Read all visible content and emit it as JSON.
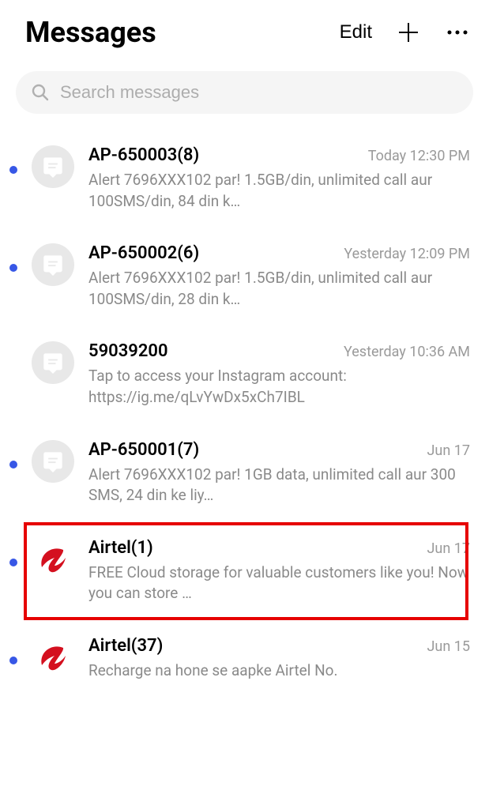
{
  "header": {
    "title": "Messages",
    "edit_label": "Edit"
  },
  "search": {
    "placeholder": "Search messages"
  },
  "conversations": [
    {
      "title": "AP-650003(8)",
      "time": "Today 12:30 PM",
      "preview": "Alert 7696XXX102 par! 1.5GB/din, unlimited call aur 100SMS/din, 84 din k…",
      "unread": true,
      "avatar": "chat",
      "highlighted": false
    },
    {
      "title": "AP-650002(6)",
      "time": "Yesterday 12:09 PM",
      "preview": "Alert 7696XXX102 par! 1.5GB/din, unlimited call aur 100SMS/din, 28 din k…",
      "unread": true,
      "avatar": "chat",
      "highlighted": false
    },
    {
      "title": "59039200",
      "time": "Yesterday 10:36 AM",
      "preview": "Tap to access your Instagram account: https://ig.me/qLvYwDx5xCh7IBL",
      "unread": false,
      "avatar": "chat",
      "highlighted": false
    },
    {
      "title": "AP-650001(7)",
      "time": "Jun 17",
      "preview": "Alert 7696XXX102 par!  1GB data, unlimited call aur 300 SMS, 24 din ke liy…",
      "unread": true,
      "avatar": "chat",
      "highlighted": false
    },
    {
      "title": "Airtel(1)",
      "time": "Jun 17",
      "preview": "FREE Cloud storage for valuable customers like you! Now you can store …",
      "unread": true,
      "avatar": "airtel",
      "highlighted": true
    },
    {
      "title": "Airtel(37)",
      "time": "Jun 15",
      "preview": "Recharge na hone se aapke Airtel No.",
      "unread": true,
      "avatar": "airtel",
      "highlighted": false
    }
  ]
}
